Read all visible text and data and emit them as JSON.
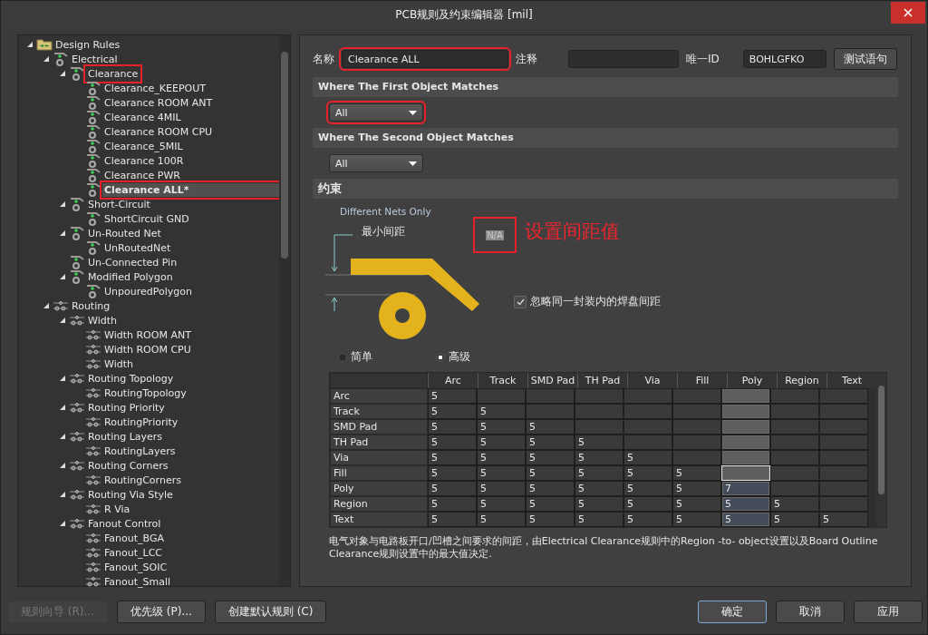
{
  "window": {
    "title": "PCB规则及约束编辑器 [mil]"
  },
  "tree": [
    {
      "label": "Design Rules",
      "kind": "folder",
      "expanded": true,
      "selected": false,
      "annotated": false,
      "children": [
        {
          "label": "Electrical",
          "kind": "electrical",
          "expanded": true,
          "selected": false,
          "annotated": false,
          "children": [
            {
              "label": "Clearance",
              "kind": "electrical",
              "expanded": true,
              "selected": false,
              "annotated": true,
              "children": [
                {
                  "label": "Clearance_KEEPOUT",
                  "kind": "electrical",
                  "selected": false,
                  "annotated": false
                },
                {
                  "label": "Clearance ROOM ANT",
                  "kind": "electrical",
                  "selected": false,
                  "annotated": false
                },
                {
                  "label": "Clearance 4MIL",
                  "kind": "electrical",
                  "selected": false,
                  "annotated": false
                },
                {
                  "label": "Clearance ROOM CPU",
                  "kind": "electrical",
                  "selected": false,
                  "annotated": false
                },
                {
                  "label": "Clearance_5MIL",
                  "kind": "electrical",
                  "selected": false,
                  "annotated": false
                },
                {
                  "label": "Clearance 100R",
                  "kind": "electrical",
                  "selected": false,
                  "annotated": false
                },
                {
                  "label": "Clearance PWR",
                  "kind": "electrical",
                  "selected": false,
                  "annotated": false
                },
                {
                  "label": "Clearance ALL*",
                  "kind": "electrical",
                  "selected": true,
                  "annotated": true
                }
              ]
            },
            {
              "label": "Short-Circuit",
              "kind": "electrical",
              "expanded": true,
              "selected": false,
              "annotated": false,
              "children": [
                {
                  "label": "ShortCircuit GND",
                  "kind": "electrical",
                  "selected": false,
                  "annotated": false
                }
              ]
            },
            {
              "label": "Un-Routed Net",
              "kind": "electrical",
              "expanded": true,
              "selected": false,
              "annotated": false,
              "children": [
                {
                  "label": "UnRoutedNet",
                  "kind": "electrical",
                  "selected": false,
                  "annotated": false
                }
              ]
            },
            {
              "label": "Un-Connected Pin",
              "kind": "electrical",
              "selected": false,
              "annotated": false
            },
            {
              "label": "Modified Polygon",
              "kind": "electrical",
              "expanded": true,
              "selected": false,
              "annotated": false,
              "children": [
                {
                  "label": "UnpouredPolygon",
                  "kind": "electrical",
                  "selected": false,
                  "annotated": false
                }
              ]
            }
          ]
        },
        {
          "label": "Routing",
          "kind": "routing",
          "expanded": true,
          "selected": false,
          "annotated": false,
          "children": [
            {
              "label": "Width",
              "kind": "routing",
              "expanded": true,
              "selected": false,
              "annotated": false,
              "children": [
                {
                  "label": "Width ROOM ANT",
                  "kind": "routing",
                  "selected": false,
                  "annotated": false
                },
                {
                  "label": "Width ROOM CPU",
                  "kind": "routing",
                  "selected": false,
                  "annotated": false
                },
                {
                  "label": "Width",
                  "kind": "routing",
                  "selected": false,
                  "annotated": false
                }
              ]
            },
            {
              "label": "Routing Topology",
              "kind": "routing",
              "expanded": true,
              "selected": false,
              "annotated": false,
              "children": [
                {
                  "label": "RoutingTopology",
                  "kind": "routing",
                  "selected": false,
                  "annotated": false
                }
              ]
            },
            {
              "label": "Routing Priority",
              "kind": "routing",
              "expanded": true,
              "selected": false,
              "annotated": false,
              "children": [
                {
                  "label": "RoutingPriority",
                  "kind": "routing",
                  "selected": false,
                  "annotated": false
                }
              ]
            },
            {
              "label": "Routing Layers",
              "kind": "routing",
              "expanded": true,
              "selected": false,
              "annotated": false,
              "children": [
                {
                  "label": "RoutingLayers",
                  "kind": "routing",
                  "selected": false,
                  "annotated": false
                }
              ]
            },
            {
              "label": "Routing Corners",
              "kind": "routing",
              "expanded": true,
              "selected": false,
              "annotated": false,
              "children": [
                {
                  "label": "RoutingCorners",
                  "kind": "routing",
                  "selected": false,
                  "annotated": false
                }
              ]
            },
            {
              "label": "Routing Via Style",
              "kind": "routing",
              "expanded": true,
              "selected": false,
              "annotated": false,
              "children": [
                {
                  "label": "R Via",
                  "kind": "routing",
                  "selected": false,
                  "annotated": false
                }
              ]
            },
            {
              "label": "Fanout Control",
              "kind": "routing",
              "expanded": true,
              "selected": false,
              "annotated": false,
              "children": [
                {
                  "label": "Fanout_BGA",
                  "kind": "routing",
                  "selected": false,
                  "annotated": false
                },
                {
                  "label": "Fanout_LCC",
                  "kind": "routing",
                  "selected": false,
                  "annotated": false
                },
                {
                  "label": "Fanout_SOIC",
                  "kind": "routing",
                  "selected": false,
                  "annotated": false
                },
                {
                  "label": "Fanout_Small",
                  "kind": "routing",
                  "selected": false,
                  "annotated": false
                }
              ]
            }
          ]
        }
      ]
    }
  ],
  "header": {
    "name_label": "名称",
    "name_value": "Clearance ALL",
    "name_annotated": true,
    "comment_label": "注释",
    "id_label": "唯一ID",
    "id_value": "BOHLGFKO",
    "test_button": "测试语句"
  },
  "first_match": {
    "title": "Where The First Object Matches",
    "value": "All",
    "annotated": true
  },
  "second_match": {
    "title": "Where The Second Object Matches",
    "value": "All",
    "annotated": false
  },
  "constraints": {
    "title": "约束",
    "nets_label": "Different Nets Only",
    "min_label": "最小间距",
    "min_value": "N/A",
    "min_annotated": true,
    "annotation": "设置间距值",
    "ignore_label": "忽略同一封装内的焊盘间距",
    "ignore_checked": true,
    "modes": [
      {
        "label": "简单",
        "selected": false
      },
      {
        "label": "高级",
        "selected": true
      }
    ]
  },
  "matrix": {
    "columns": [
      {
        "label": "Arc",
        "selected": false
      },
      {
        "label": "Track",
        "selected": false
      },
      {
        "label": "SMD Pad",
        "selected": false
      },
      {
        "label": "TH Pad",
        "selected": false
      },
      {
        "label": "Via",
        "selected": false
      },
      {
        "label": "Fill",
        "selected": false
      },
      {
        "label": "Poly",
        "selected": true
      },
      {
        "label": "Region",
        "selected": false
      },
      {
        "label": "Text",
        "selected": false
      }
    ],
    "rows": [
      {
        "label": "Arc",
        "cells": [
          {
            "value": "5",
            "focused": false
          },
          {
            "focused": false
          },
          {
            "focused": false
          },
          {
            "focused": false
          },
          {
            "focused": false
          },
          {
            "focused": false
          },
          {
            "focused": false
          },
          {
            "focused": false
          },
          {
            "focused": false
          }
        ]
      },
      {
        "label": "Track",
        "cells": [
          {
            "value": "5",
            "focused": false
          },
          {
            "value": "5",
            "focused": false
          },
          {
            "focused": false
          },
          {
            "focused": false
          },
          {
            "focused": false
          },
          {
            "focused": false
          },
          {
            "focused": false
          },
          {
            "focused": false
          },
          {
            "focused": false
          }
        ]
      },
      {
        "label": "SMD Pad",
        "cells": [
          {
            "value": "5",
            "focused": false
          },
          {
            "value": "5",
            "focused": false
          },
          {
            "value": "5",
            "focused": false
          },
          {
            "focused": false
          },
          {
            "focused": false
          },
          {
            "focused": false
          },
          {
            "focused": false
          },
          {
            "focused": false
          },
          {
            "focused": false
          }
        ]
      },
      {
        "label": "TH Pad",
        "cells": [
          {
            "value": "5",
            "focused": false
          },
          {
            "value": "5",
            "focused": false
          },
          {
            "value": "5",
            "focused": false
          },
          {
            "value": "5",
            "focused": false
          },
          {
            "focused": false
          },
          {
            "focused": false
          },
          {
            "focused": false
          },
          {
            "focused": false
          },
          {
            "focused": false
          }
        ]
      },
      {
        "label": "Via",
        "cells": [
          {
            "value": "5",
            "focused": false
          },
          {
            "value": "5",
            "focused": false
          },
          {
            "value": "5",
            "focused": false
          },
          {
            "value": "5",
            "focused": false
          },
          {
            "value": "5",
            "focused": false
          },
          {
            "focused": false
          },
          {
            "focused": false
          },
          {
            "focused": false
          },
          {
            "focused": false
          }
        ]
      },
      {
        "label": "Fill",
        "cells": [
          {
            "value": "5",
            "focused": false
          },
          {
            "value": "5",
            "focused": false
          },
          {
            "value": "5",
            "focused": false
          },
          {
            "value": "5",
            "focused": false
          },
          {
            "value": "5",
            "focused": false
          },
          {
            "value": "5",
            "focused": false
          },
          {
            "focused": true
          },
          {
            "focused": false
          },
          {
            "focused": false
          }
        ]
      },
      {
        "label": "Poly",
        "cells": [
          {
            "value": "5",
            "focused": false
          },
          {
            "value": "5",
            "focused": false
          },
          {
            "value": "5",
            "focused": false
          },
          {
            "value": "5",
            "focused": false
          },
          {
            "value": "5",
            "focused": false
          },
          {
            "value": "5",
            "focused": false
          },
          {
            "value": "7",
            "focused": false
          },
          {
            "focused": false
          },
          {
            "focused": false
          }
        ]
      },
      {
        "label": "Region",
        "cells": [
          {
            "value": "5",
            "focused": false
          },
          {
            "value": "5",
            "focused": false
          },
          {
            "value": "5",
            "focused": false
          },
          {
            "value": "5",
            "focused": false
          },
          {
            "value": "5",
            "focused": false
          },
          {
            "value": "5",
            "focused": false
          },
          {
            "value": "5",
            "focused": false
          },
          {
            "value": "5",
            "focused": false
          },
          {
            "focused": false
          }
        ]
      },
      {
        "label": "Text",
        "cells": [
          {
            "value": "5",
            "focused": false
          },
          {
            "value": "5",
            "focused": false
          },
          {
            "value": "5",
            "focused": false
          },
          {
            "value": "5",
            "focused": false
          },
          {
            "value": "5",
            "focused": false
          },
          {
            "value": "5",
            "focused": false
          },
          {
            "value": "5",
            "focused": false
          },
          {
            "value": "5",
            "focused": false
          },
          {
            "value": "5",
            "focused": false
          }
        ]
      }
    ]
  },
  "description": "电气对象与电路板开口/凹槽之间要求的间距，由Electrical Clearance规则中的Region -to- object设置以及Board Outline Clearance规则设置中的最大值决定.",
  "left_buttons": [
    {
      "label": "规则向导 (R)...",
      "disabled": true
    },
    {
      "label": "优先级 (P)...",
      "disabled": false
    },
    {
      "label": "创建默认规则 (C)",
      "disabled": false
    }
  ],
  "right_buttons": [
    {
      "label": "确定",
      "focused": true
    },
    {
      "label": "取消",
      "focused": false
    },
    {
      "label": "应用",
      "focused": false
    }
  ]
}
